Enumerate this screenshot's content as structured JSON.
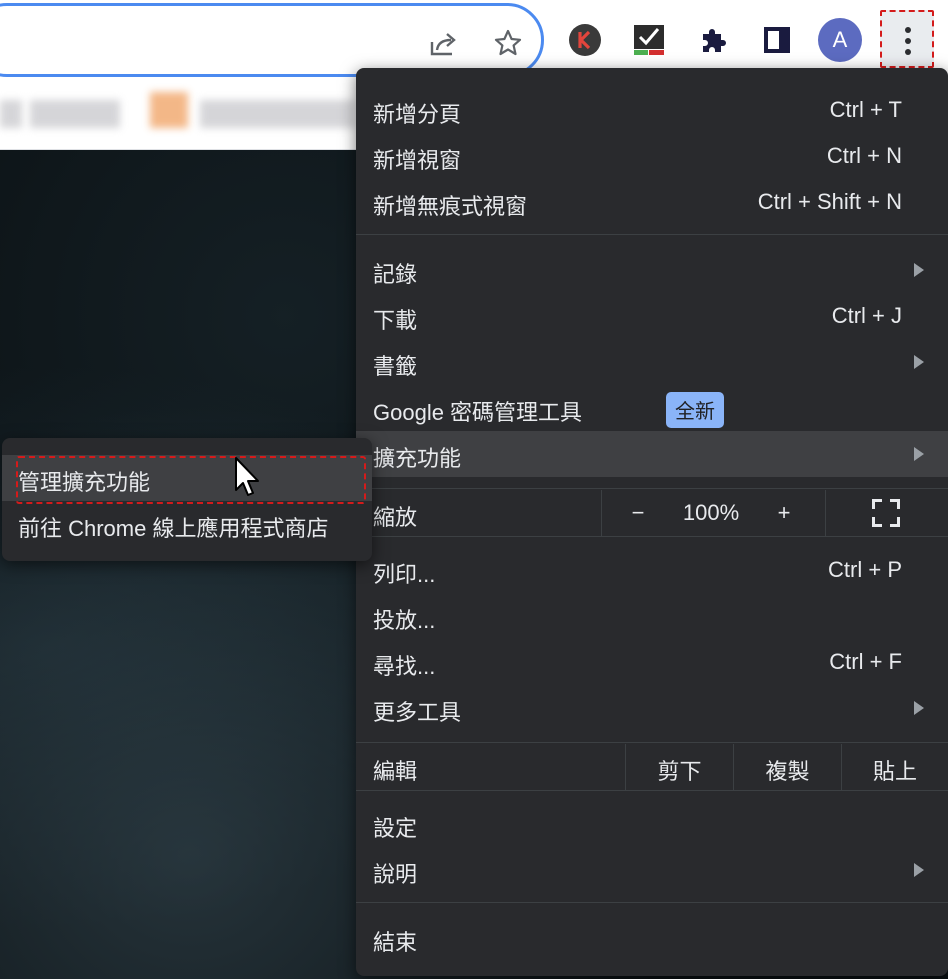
{
  "toolbar": {
    "share_icon": "share-icon",
    "bookmark_icon": "star-icon",
    "profile_letter": "A",
    "extensions_icon": "puzzle-icon",
    "menu_icon": "three-dots-vertical-icon"
  },
  "menu": {
    "items": [
      {
        "label": "新增分頁",
        "shortcut": "Ctrl + T"
      },
      {
        "label": "新增視窗",
        "shortcut": "Ctrl + N"
      },
      {
        "label": "新增無痕式視窗",
        "shortcut": "Ctrl + Shift + N"
      },
      {
        "label": "記錄"
      },
      {
        "label": "下載",
        "shortcut": "Ctrl + J"
      },
      {
        "label": "書籤"
      },
      {
        "label": "Google 密碼管理工具",
        "badge": "全新"
      },
      {
        "label": "擴充功能"
      },
      {
        "label": "列印...",
        "shortcut": "Ctrl + P"
      },
      {
        "label": "投放..."
      },
      {
        "label": "尋找...",
        "shortcut": "Ctrl + F"
      },
      {
        "label": "更多工具"
      },
      {
        "label": "設定"
      },
      {
        "label": "說明"
      },
      {
        "label": "結束"
      }
    ],
    "zoom": {
      "label": "縮放",
      "minus": "−",
      "value": "100%",
      "plus": "+"
    },
    "edit": {
      "label": "編輯",
      "cut": "剪下",
      "copy": "複製",
      "paste": "貼上"
    }
  },
  "submenu": {
    "items": [
      {
        "label": "管理擴充功能"
      },
      {
        "label": "前往 Chrome 線上應用程式商店"
      }
    ]
  },
  "colors": {
    "menu_bg": "#292a2d",
    "menu_text": "#e8eaed",
    "highlight": "#3f4043",
    "badge_bg": "#8ab4f8",
    "annotation": "#d41b1b",
    "omnibox_border": "#4b8af0"
  }
}
